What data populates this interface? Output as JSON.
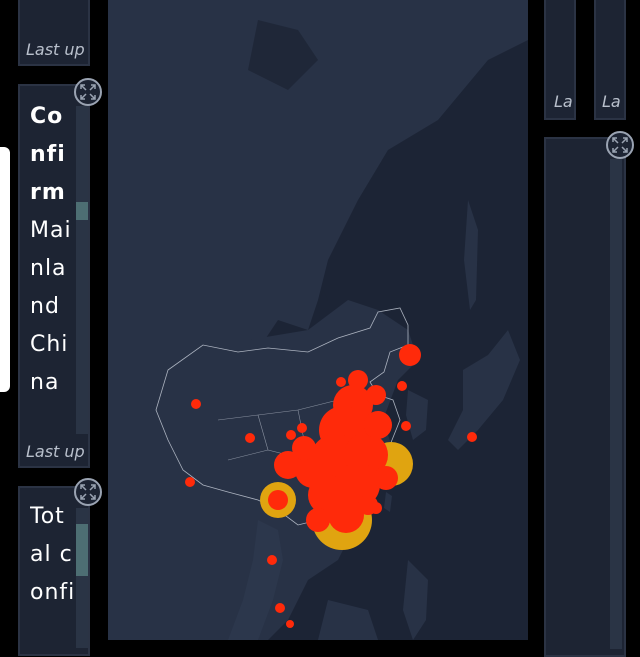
{
  "top_panel": {
    "updated_text": "Last up"
  },
  "confirmed_panel": {
    "title": "Confirm",
    "subtitle": "Mainland China",
    "updated_text": "Last up"
  },
  "total_panel": {
    "title": "Total confi"
  },
  "right_panels": {
    "updated_a": "La",
    "updated_b": "La"
  },
  "icons": {
    "expand": "expand-arrows-icon"
  },
  "colors": {
    "map_water": "#1c2435",
    "land": "#283246",
    "case_dot": "#ff2a0a",
    "case_ring": "#e0a410"
  }
}
